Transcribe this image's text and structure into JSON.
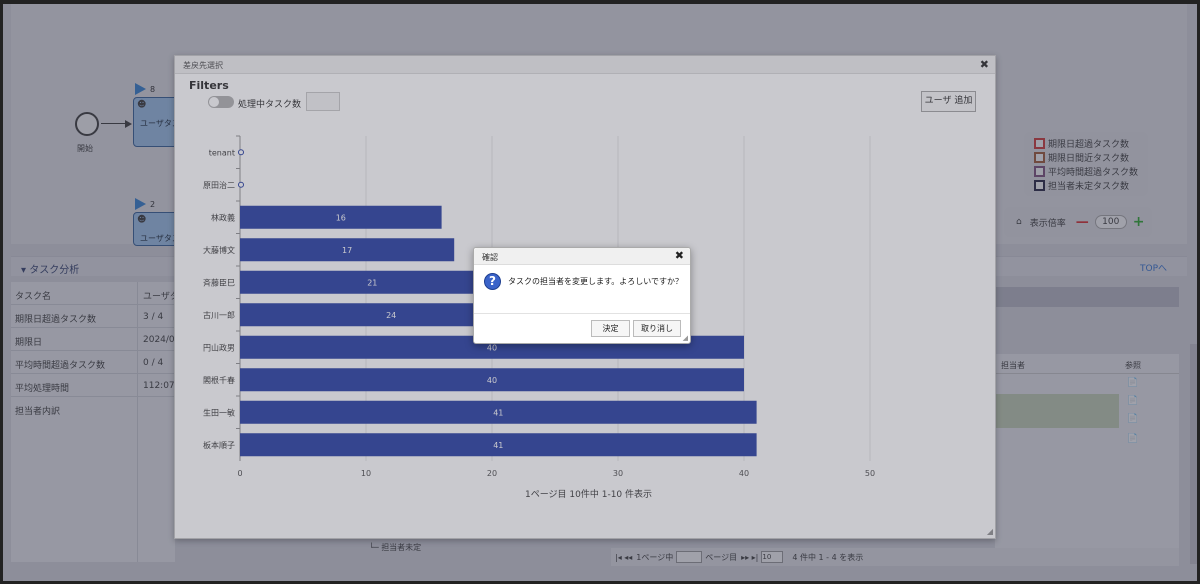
{
  "background": {
    "diagram": {
      "start_label": "開始",
      "tasks": [
        {
          "flag_count": "8",
          "label": "ユーザタス"
        },
        {
          "flag_count": "2",
          "label": "ユーザタス"
        }
      ]
    },
    "legend": [
      {
        "label": "期限日超過タスク数",
        "color": "#d32f2f"
      },
      {
        "label": "期限日間近タスク数",
        "color": "#a0522d"
      },
      {
        "label": "平均時間超過タスク数",
        "color": "#7a4a7a"
      },
      {
        "label": "担当者未定タスク数",
        "color": "#1a1a3a"
      }
    ],
    "zoom": {
      "label": "表示倍率",
      "value": "100"
    },
    "section": {
      "title": "タスク分析",
      "top_link": "TOPへ"
    },
    "info_rows": [
      {
        "key": "タスク名",
        "value": "ユーザタ"
      },
      {
        "key": "期限日超過タスク数",
        "value": "3 / 4"
      },
      {
        "key": "期限日",
        "value": "2024/03"
      },
      {
        "key": "平均時間超過タスク数",
        "value": "0 / 4"
      },
      {
        "key": "平均処理時間",
        "value": "112:07:2"
      },
      {
        "key": "担当者内訳",
        "value": ""
      }
    ],
    "grid": {
      "col_assignee": "担当者",
      "col_ref": "参照"
    },
    "tree_label": "担当者未定",
    "pager": {
      "prev": "|◂ ◂◂",
      "page_prefix": "1ページ中",
      "page_suffix": "ページ目",
      "next": "▸▸ ▸|",
      "per_page": "10",
      "summary": "4 件中 1 - 4 を表示"
    }
  },
  "modal": {
    "title": "差戻先選択",
    "filters_label": "Filters",
    "toggle_label": "処理中タスク数",
    "user_add_button": "ユーザ 追加",
    "pager_text": "1ページ目 10件中 1-10 件表示"
  },
  "chart_data": {
    "type": "bar",
    "orientation": "horizontal",
    "categories": [
      "tenant",
      "原田治二",
      "林政義",
      "大藤博文",
      "斉藤臣巳",
      "古川一郎",
      "円山政男",
      "閣根千春",
      "生田一敏",
      "板本順子"
    ],
    "values": [
      0,
      0,
      16,
      17,
      21,
      24,
      40,
      40,
      41,
      41
    ],
    "xlim": [
      0,
      50
    ],
    "x_ticks": [
      0,
      10,
      20,
      30,
      40,
      50
    ],
    "grid": true,
    "bar_color": "#3249a8"
  },
  "confirm": {
    "title": "確認",
    "message": "タスクの担当者を変更します。よろしいですか？",
    "ok_label": "決定",
    "cancel_label": "取り消し"
  }
}
